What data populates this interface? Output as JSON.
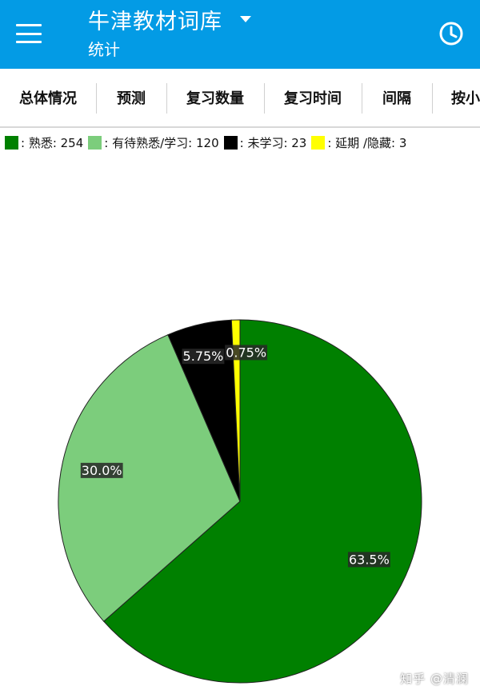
{
  "app_bar": {
    "title": "牛津教材词库",
    "subtitle": "统计",
    "background": "#039BE5",
    "menu_icon": "hamburger-menu-icon",
    "dropdown_icon": "caret-down-icon",
    "history_icon": "clock-icon"
  },
  "tabs": [
    {
      "label": "总体情况",
      "selected": true
    },
    {
      "label": "预测"
    },
    {
      "label": "复习数量"
    },
    {
      "label": "复习时间"
    },
    {
      "label": "间隔"
    },
    {
      "label": "按小"
    }
  ],
  "legend": [
    {
      "label": ": 熟悉: 254",
      "color": "#008000"
    },
    {
      "label": ": 有待熟悉/学习: 120",
      "color": "#7CCD7C"
    },
    {
      "label": ": 未学习: 23",
      "color": "#000000"
    },
    {
      "label": ": 延期 /隐藏: 3",
      "color": "#FFFF00"
    }
  ],
  "chart_data": {
    "type": "pie",
    "categories": [
      "熟悉",
      "有待熟悉/学习",
      "未学习",
      "延期 /隐藏"
    ],
    "values": [
      254,
      120,
      23,
      3
    ],
    "percent_labels": [
      "63.5%",
      "30.0%",
      "5.75%",
      "0.75%"
    ],
    "colors": [
      "#008000",
      "#7CCD7C",
      "#000000",
      "#FFFF00"
    ],
    "start_angle": "12 o'clock",
    "direction": "clockwise"
  },
  "watermark": "知乎 @清澜"
}
